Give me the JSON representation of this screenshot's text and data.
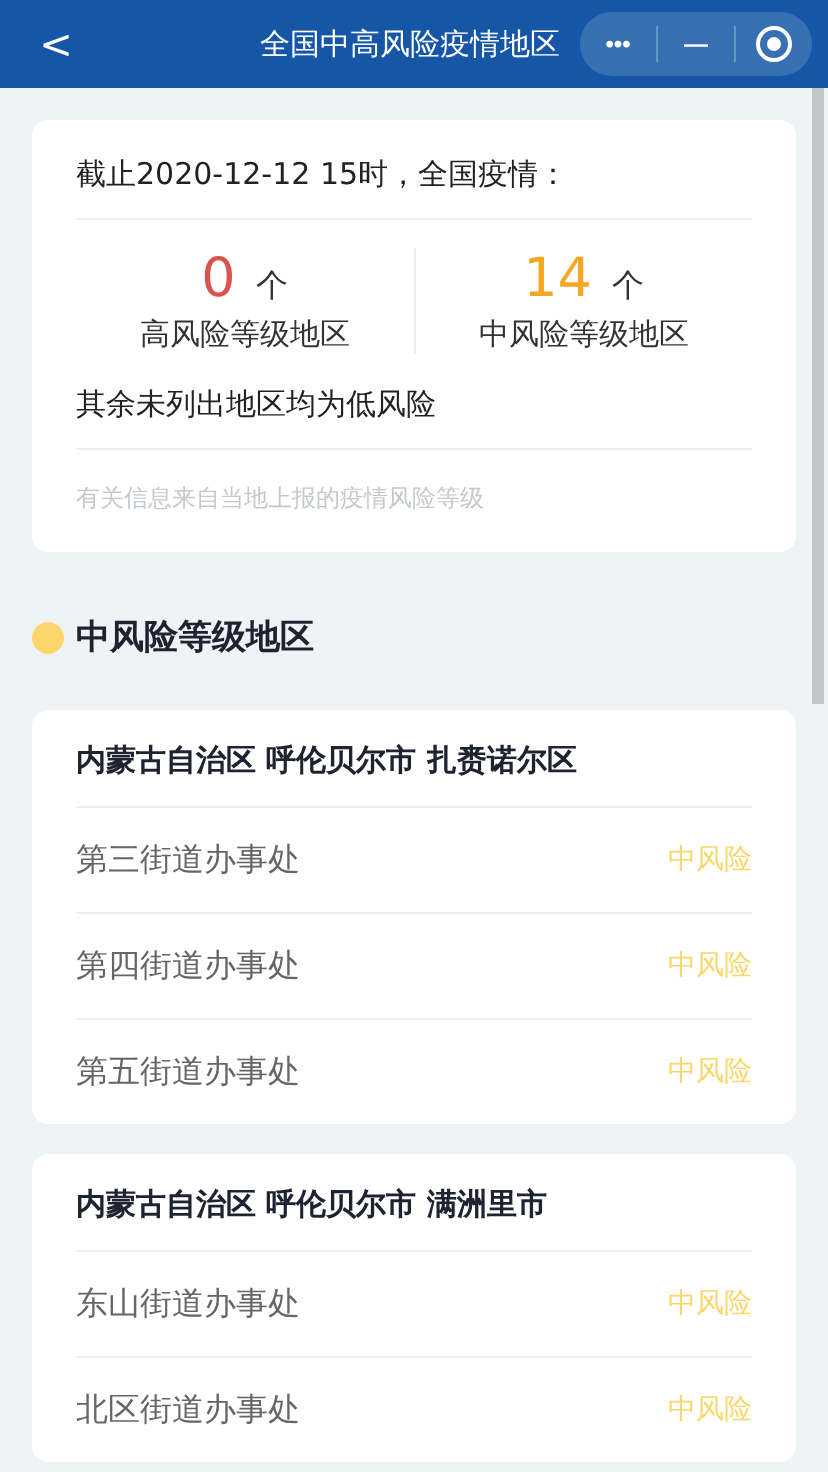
{
  "nav": {
    "back": "<",
    "title": "全国中高风险疫情地区",
    "more": "•••",
    "minimize": "—"
  },
  "summary": {
    "heading": "截止2020-12-12 15时，全国疫情：",
    "stats": [
      {
        "count": "0",
        "unit": "个",
        "label": "高风险等级地区",
        "color": "#d9534f"
      },
      {
        "count": "14",
        "unit": "个",
        "label": "中风险等级地区",
        "color": "#f5a623"
      }
    ],
    "note": "其余未列出地区均为低风险",
    "source": "有关信息来自当地上报的疫情风险等级"
  },
  "section": {
    "title": "中风险等级地区",
    "color": "#fbd66a"
  },
  "areas": [
    {
      "name": "内蒙古自治区 呼伦贝尔市 扎赉诺尔区",
      "rows": [
        {
          "place": "第三街道办事处",
          "risk": "中风险"
        },
        {
          "place": "第四街道办事处",
          "risk": "中风险"
        },
        {
          "place": "第五街道办事处",
          "risk": "中风险"
        }
      ]
    },
    {
      "name": "内蒙古自治区 呼伦贝尔市 满洲里市",
      "rows": [
        {
          "place": "东山街道办事处",
          "risk": "中风险"
        },
        {
          "place": "北区街道办事处",
          "risk": "中风险"
        }
      ]
    }
  ]
}
